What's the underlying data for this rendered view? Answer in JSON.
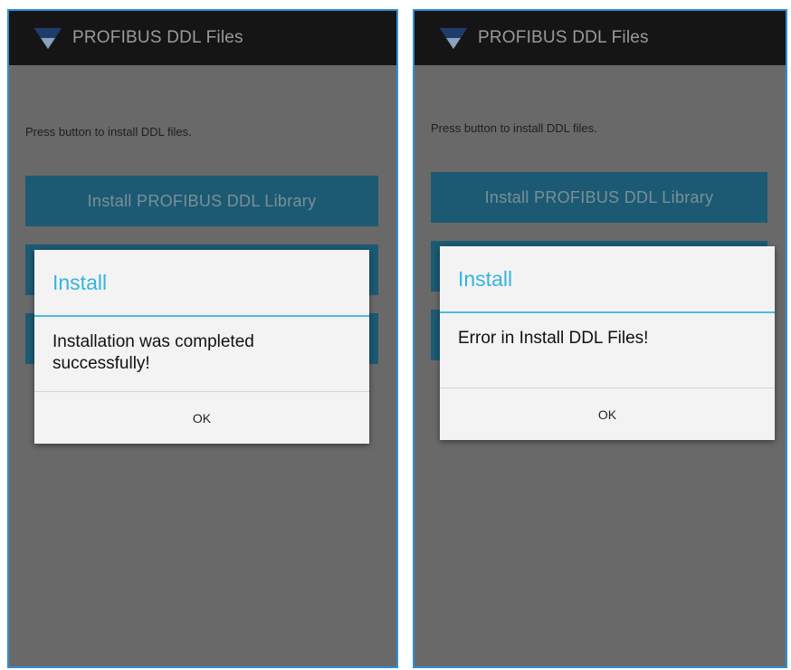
{
  "app": {
    "title": "PROFIBUS DDL Files",
    "logo_icon": "profibus-logo-icon"
  },
  "colors": {
    "action_bar": "#151515",
    "screen_dimmed": "#696969",
    "button": "#1c5a73",
    "dialog_accent": "#35b4e0",
    "frame_border": "#2f8fd9"
  },
  "screens": [
    {
      "instruction": "Press button to install DDL files.",
      "main_button": "Install PROFIBUS DDL Library",
      "dialog": {
        "title": "Install",
        "message": "Installation was completed successfully!",
        "ok": "OK"
      }
    },
    {
      "instruction": "Press button to install DDL files.",
      "main_button": "Install PROFIBUS DDL Library",
      "dialog": {
        "title": "Install",
        "message": "Error in Install DDL Files!",
        "ok": "OK"
      }
    }
  ]
}
